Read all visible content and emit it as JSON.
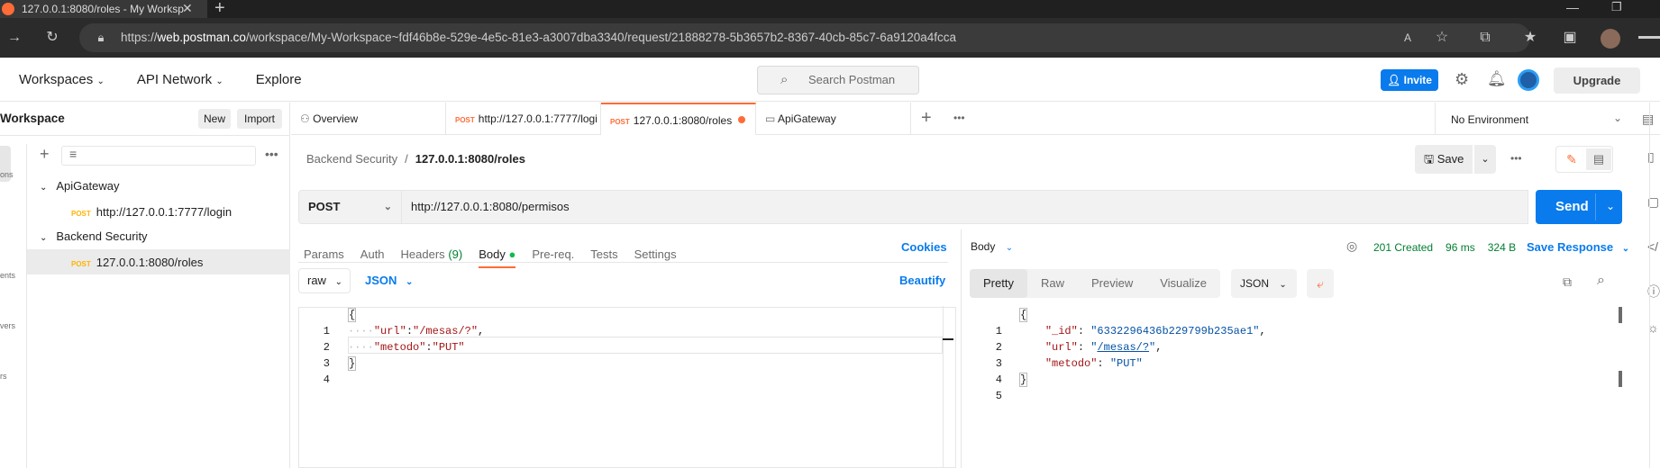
{
  "browser": {
    "tab_title": "127.0.0.1:8080/roles - My Worksp",
    "url_prefix": "https://",
    "url_host": "web.postman.co",
    "url_path": "/workspace/My-Workspace~fdf46b8e-529e-4e5c-81e3-a3007dba3340/request/21888278-5b3657b2-8367-40cb-85c7-6a9120a4fcca"
  },
  "header": {
    "nav": [
      "Workspaces",
      "API Network",
      "Explore"
    ],
    "search_placeholder": "Search Postman",
    "invite_label": "Invite",
    "upgrade_label": "Upgrade"
  },
  "sidebar": {
    "title": "Workspace",
    "new_label": "New",
    "import_label": "Import",
    "rail_labels": [
      "ons",
      "ents",
      "vers",
      "rs"
    ],
    "tree": [
      {
        "label": "ApiGateway",
        "type": "folder"
      },
      {
        "label": "http://127.0.0.1:7777/login",
        "type": "request",
        "method": "POST"
      },
      {
        "label": "Backend Security",
        "type": "folder"
      },
      {
        "label": "127.0.0.1:8080/roles",
        "type": "request",
        "method": "POST"
      }
    ]
  },
  "tabs": [
    {
      "label": "Overview",
      "method": ""
    },
    {
      "label": "http://127.0.0.1:7777/logi",
      "method": "POST"
    },
    {
      "label": "127.0.0.1:8080/roles",
      "method": "POST"
    },
    {
      "label": "ApiGateway",
      "method": ""
    }
  ],
  "environment": "No Environment",
  "breadcrumb": {
    "parent": "Backend Security",
    "sep": "/",
    "current": "127.0.0.1:8080/roles"
  },
  "save_label": "Save",
  "request": {
    "method": "POST",
    "url": "http://127.0.0.1:8080/permisos",
    "send_label": "Send",
    "subtabs": [
      "Params",
      "Auth",
      "Headers",
      "(9)",
      "Body",
      "Pre-req.",
      "Tests",
      "Settings"
    ],
    "cookies_label": "Cookies",
    "body_mode": "raw",
    "body_lang": "JSON",
    "beautify_label": "Beautify",
    "body_lines": [
      "1",
      "2",
      "3",
      "4"
    ]
  },
  "response": {
    "body_label": "Body",
    "status": "201 Created",
    "time": "96 ms",
    "size": "324 B",
    "save_response_label": "Save Response",
    "view_tabs": [
      "Pretty",
      "Raw",
      "Preview",
      "Visualize"
    ],
    "format": "JSON",
    "lines": [
      "1",
      "2",
      "3",
      "4",
      "5"
    ]
  },
  "colors": {
    "brand": "#ff6c37",
    "accent": "#097bed",
    "status_ok": "#007f31"
  }
}
